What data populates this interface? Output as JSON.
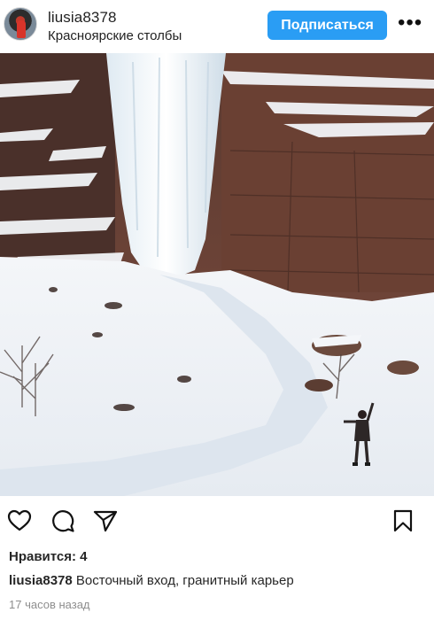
{
  "header": {
    "username": "liusia8378",
    "location": "Красноярские столбы",
    "follow_label": "Подписаться",
    "more_label": "•••",
    "avatar_icon": "avatar-photo"
  },
  "post": {
    "image_icon": "winter-waterfall-photo"
  },
  "actions": {
    "like_icon": "heart-icon",
    "comment_icon": "speech-bubble-icon",
    "share_icon": "paper-plane-icon",
    "save_icon": "bookmark-icon"
  },
  "likes": {
    "text": "Нравится: 4"
  },
  "caption": {
    "username": "liusia8378",
    "text": "Восточный вход, гранитный карьер"
  },
  "timestamp": "17 часов назад",
  "colors": {
    "accent": "#2a9df4",
    "text": "#262626",
    "muted": "#8e8e8e"
  }
}
